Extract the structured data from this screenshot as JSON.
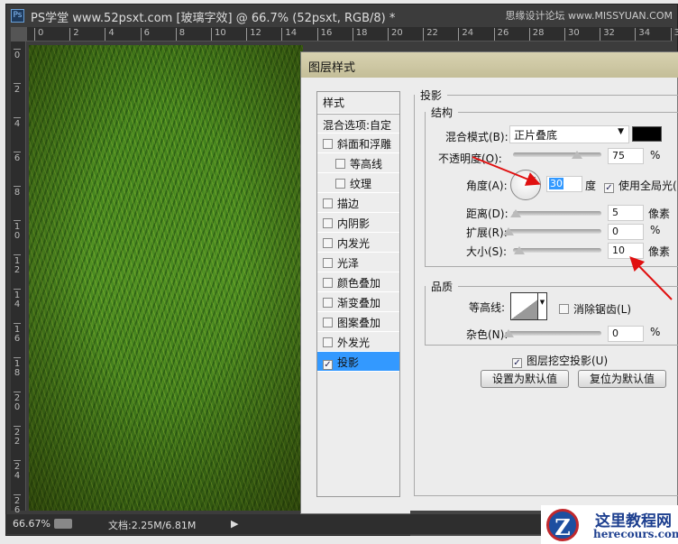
{
  "window": {
    "app_icon": "Ps",
    "title": "PS学堂 www.52psxt.com [玻璃字效] @ 66.7% (52psxt, RGB/8) *",
    "top_watermark": "思缘设计论坛 www.MISSYUAN.COM"
  },
  "ruler_top": [
    "0",
    "2",
    "4",
    "6",
    "8",
    "10",
    "12",
    "14",
    "16",
    "18",
    "20",
    "22",
    "24",
    "26",
    "28",
    "30",
    "32",
    "34",
    "3"
  ],
  "ruler_left": [
    "0",
    "2",
    "4",
    "6",
    "8",
    "1\n0",
    "1\n2",
    "1\n4",
    "1\n6",
    "1\n8",
    "2\n0",
    "2\n2",
    "2\n4",
    "2\n6"
  ],
  "dialog": {
    "title": "图层样式",
    "styles_header": "样式",
    "blend_options": "混合选项:自定",
    "items": [
      {
        "label": "斜面和浮雕",
        "checked": false
      },
      {
        "label": "等高线",
        "checked": false
      },
      {
        "label": "纹理",
        "checked": false
      },
      {
        "label": "描边",
        "checked": false
      },
      {
        "label": "内阴影",
        "checked": false
      },
      {
        "label": "内发光",
        "checked": false
      },
      {
        "label": "光泽",
        "checked": false
      },
      {
        "label": "颜色叠加",
        "checked": false
      },
      {
        "label": "渐变叠加",
        "checked": false
      },
      {
        "label": "图案叠加",
        "checked": false
      },
      {
        "label": "外发光",
        "checked": false
      },
      {
        "label": "投影",
        "checked": true
      }
    ],
    "section_title": "投影",
    "structure": {
      "title": "结构",
      "blend_mode_label": "混合模式(B):",
      "blend_mode_value": "正片叠底",
      "shadow_color": "#000000",
      "opacity_label": "不透明度(O):",
      "opacity_value": "75",
      "opacity_unit": "%",
      "angle_label": "角度(A):",
      "angle_value": "30",
      "angle_unit": "度",
      "global_light_label": "使用全局光(",
      "global_light_checked": true,
      "distance_label": "距离(D):",
      "distance_value": "5",
      "distance_unit": "像素",
      "spread_label": "扩展(R):",
      "spread_value": "0",
      "spread_unit": "%",
      "size_label": "大小(S):",
      "size_value": "10",
      "size_unit": "像素"
    },
    "quality": {
      "title": "品质",
      "contour_label": "等高线:",
      "antialias_label": "消除锯齿(L)",
      "antialias_checked": false,
      "noise_label": "杂色(N):",
      "noise_value": "0",
      "noise_unit": "%"
    },
    "knockout_label": "图层挖空投影(U)",
    "knockout_checked": true,
    "set_default": "设置为默认值",
    "reset_default": "复位为默认值"
  },
  "status": {
    "zoom": "66.67%",
    "doc": "文档:2.25M/6.81M"
  },
  "logo": {
    "title": "这里教程网",
    "url": "herecours.com"
  }
}
